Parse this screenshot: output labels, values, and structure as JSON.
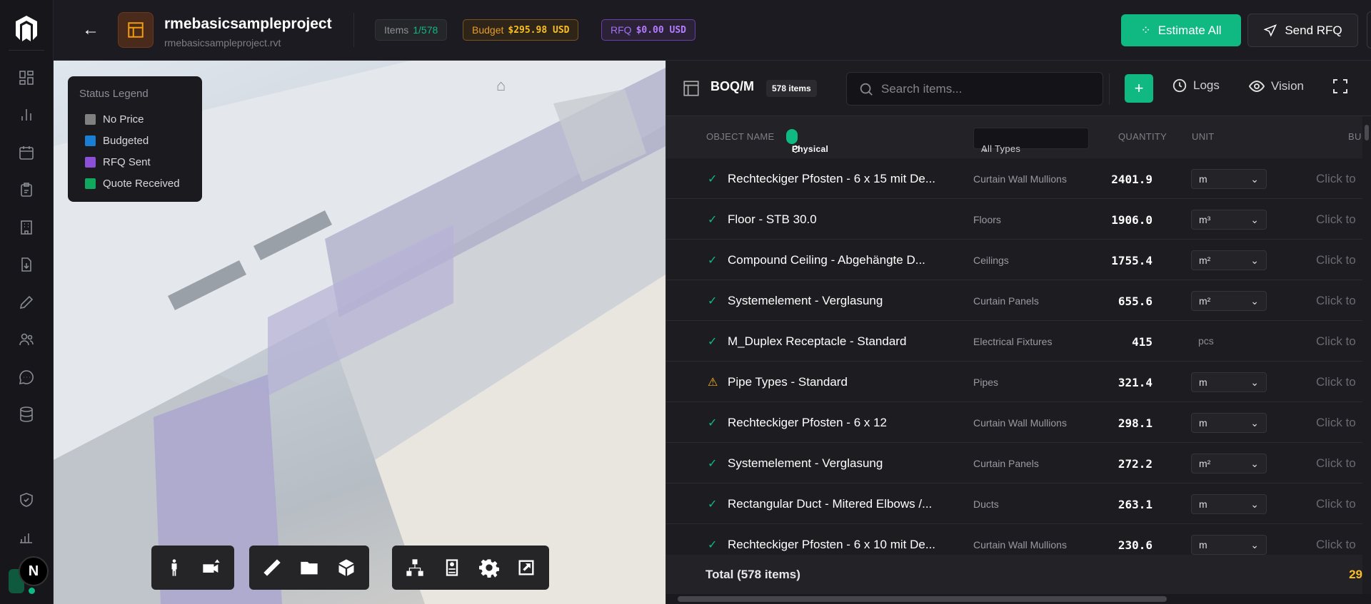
{
  "header": {
    "project_title": "rmebasicsampleproject",
    "project_file": "rmebasicsampleproject.rvt",
    "items_label": "Items",
    "items_value": "1/578",
    "budget_label": "Budget",
    "budget_value": "$295.98 USD",
    "rfq_label": "RFQ",
    "rfq_value": "$0.00 USD",
    "estimate_all": "Estimate All",
    "send_rfq": "Send RFQ"
  },
  "sidebar": {
    "avatar": "N"
  },
  "legend": {
    "title": "Status Legend",
    "items": [
      {
        "label": "No Price",
        "color": "#808080"
      },
      {
        "label": "Budgeted",
        "color": "#1a7fd4"
      },
      {
        "label": "RFQ Sent",
        "color": "#8b4fd8"
      },
      {
        "label": "Quote Received",
        "color": "#10a85f"
      }
    ]
  },
  "panel": {
    "title": "BOQ/M",
    "count": "578 items",
    "search_placeholder": "Search items...",
    "logs": "Logs",
    "vision": "Vision",
    "columns": {
      "object_name": "OBJECT NAME",
      "physical": "Physical",
      "type_filter": "All Types",
      "quantity": "QUANTITY",
      "unit": "UNIT",
      "budget": "BU"
    },
    "rows": [
      {
        "status": "ok",
        "name": "Rechteckiger Pfosten - 6 x 15 mit De...",
        "type": "Curtain Wall Mullions",
        "qty": "2401.9",
        "unit": "m",
        "action": "Click to"
      },
      {
        "status": "ok",
        "name": "Floor - STB 30.0",
        "type": "Floors",
        "qty": "1906.0",
        "unit": "m³",
        "action": "Click to"
      },
      {
        "status": "ok",
        "name": "Compound Ceiling - Abgehängte D...",
        "type": "Ceilings",
        "qty": "1755.4",
        "unit": "m²",
        "action": "Click to"
      },
      {
        "status": "ok",
        "name": "Systemelement - Verglasung",
        "type": "Curtain Panels",
        "qty": "655.6",
        "unit": "m²",
        "action": "Click to"
      },
      {
        "status": "ok",
        "name": "M_Duplex Receptacle - Standard",
        "type": "Electrical Fixtures",
        "qty": "415",
        "unit": "pcs",
        "action": "Click to"
      },
      {
        "status": "warn",
        "name": "Pipe Types - Standard",
        "type": "Pipes",
        "qty": "321.4",
        "unit": "m",
        "action": "Click to"
      },
      {
        "status": "ok",
        "name": "Rechteckiger Pfosten - 6 x 12",
        "type": "Curtain Wall Mullions",
        "qty": "298.1",
        "unit": "m",
        "action": "Click to"
      },
      {
        "status": "ok",
        "name": "Systemelement - Verglasung",
        "type": "Curtain Panels",
        "qty": "272.2",
        "unit": "m²",
        "action": "Click to"
      },
      {
        "status": "ok",
        "name": "Rectangular Duct - Mitered Elbows /...",
        "type": "Ducts",
        "qty": "263.1",
        "unit": "m",
        "action": "Click to"
      },
      {
        "status": "ok",
        "name": "Rechteckiger Pfosten - 6 x 10 mit De...",
        "type": "Curtain Wall Mullions",
        "qty": "230.6",
        "unit": "m",
        "action": "Click to"
      }
    ],
    "total_label": "Total (578 items)",
    "total_value": "29"
  }
}
